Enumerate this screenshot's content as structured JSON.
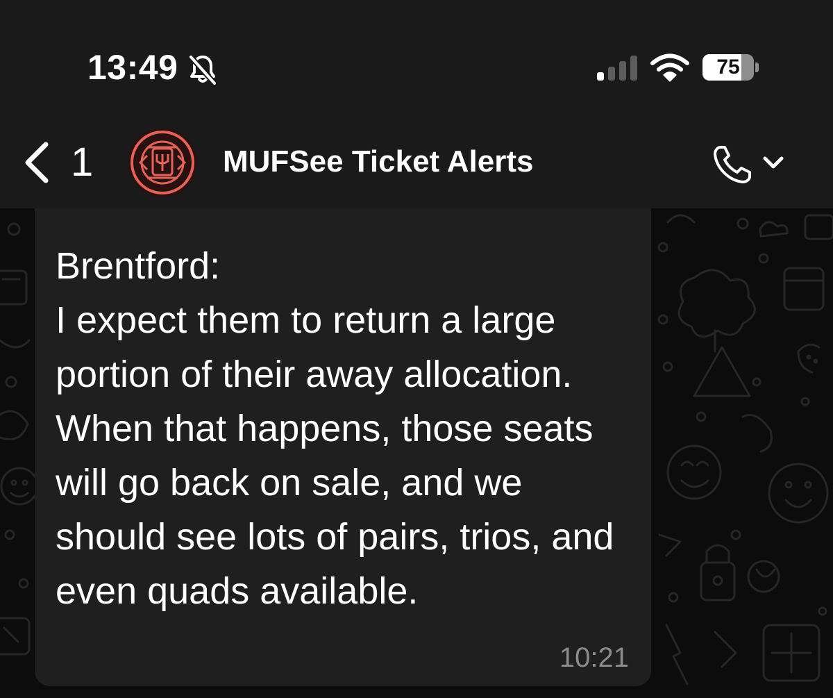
{
  "status_bar": {
    "time": "13:49",
    "battery_level": "75",
    "battery_fraction": 0.75,
    "icons": [
      "bell-off-icon",
      "signal-icon",
      "wifi-icon",
      "battery-icon"
    ]
  },
  "header": {
    "back_count": "1",
    "contact_name": "MUFSee Ticket Alerts",
    "icons": [
      "back-chevron-icon",
      "avatar",
      "phone-icon",
      "chevron-down-icon"
    ]
  },
  "colors": {
    "background": "#0b0b0b",
    "bar": "#1a1a1a",
    "bubble": "#1f1f1f",
    "avatar_accent": "#e0645c",
    "timestamp": "#8c8c8c"
  },
  "message": {
    "text": "Brentford:\nI expect them to return a large portion of their away allocation. When that happens, those seats will go back on sale, and we should see lots of pairs, trios, and even quads available.",
    "time": "10:21"
  }
}
